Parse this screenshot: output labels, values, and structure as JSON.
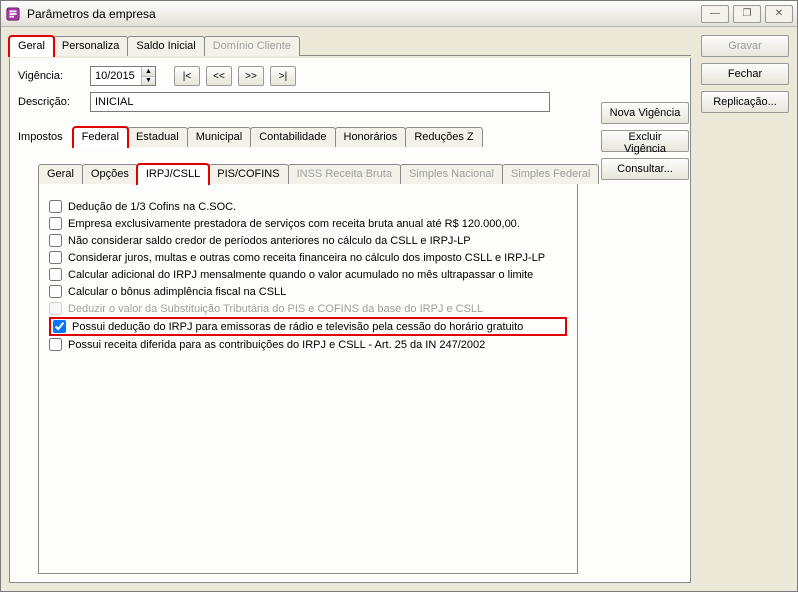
{
  "window": {
    "title": "Parâmetros da empresa"
  },
  "titlebar_buttons": {
    "minimize_glyph": "—",
    "restore_glyph": "❐",
    "close_glyph": "✕"
  },
  "main_tabs": [
    {
      "label": "Geral",
      "selected": true,
      "highlight": true
    },
    {
      "label": "Personaliza"
    },
    {
      "label": "Saldo Inicial"
    },
    {
      "label": "Domínio Cliente",
      "disabled": true
    }
  ],
  "form": {
    "vigencia_label": "Vigência:",
    "vigencia_value": "10/2015",
    "nav": {
      "first": "|<",
      "prev": "<<",
      "next": ">>",
      "last": ">|"
    },
    "descricao_label": "Descrição:",
    "descricao_value": "INICIAL"
  },
  "impostos_label": "Impostos",
  "impostos_tabs": [
    {
      "label": "Federal",
      "selected": true,
      "highlight": true
    },
    {
      "label": "Estadual"
    },
    {
      "label": "Municipal"
    },
    {
      "label": "Contabilidade"
    },
    {
      "label": "Honorários"
    },
    {
      "label": "Reduções Z"
    }
  ],
  "inner_tabs": [
    {
      "label": "Geral"
    },
    {
      "label": "Opções"
    },
    {
      "label": "IRPJ/CSLL",
      "selected": true,
      "highlight": true
    },
    {
      "label": "PIS/COFINS"
    },
    {
      "label": "INSS Receita Bruta",
      "disabled": true
    },
    {
      "label": "Simples Nacional",
      "disabled": true
    },
    {
      "label": "Simples Federal",
      "disabled": true
    }
  ],
  "checkboxes": [
    {
      "label": "Dedução de 1/3 Cofins na C.SOC.",
      "checked": false
    },
    {
      "label": "Empresa exclusivamente prestadora de serviços com receita bruta anual até R$ 120.000,00.",
      "checked": false
    },
    {
      "label": "Não considerar saldo credor de períodos anteriores no cálculo da CSLL e IRPJ-LP",
      "checked": false
    },
    {
      "label": "Considerar juros, multas e outras como receita financeira no cálculo dos imposto CSLL e IRPJ-LP",
      "checked": false
    },
    {
      "label": "Calcular adicional do IRPJ mensalmente quando o valor acumulado no mês ultrapassar o limite",
      "checked": false
    },
    {
      "label": "Calcular o bônus adimplência fiscal na CSLL",
      "checked": false
    },
    {
      "label": "Deduzir o valor da Substituição Tributária do PIS e COFINS da base do IRPJ e CSLL",
      "checked": false,
      "disabled": true
    },
    {
      "label": "Possui dedução do IRPJ para emissoras de rádio e televisão pela cessão do horário gratuito",
      "checked": true,
      "highlight": true
    },
    {
      "label": "Possui receita diferida para as contribuições do IRPJ e CSLL - Art. 25 da IN 247/2002",
      "checked": false
    }
  ],
  "side_buttons": {
    "nova_vigencia": "Nova Vigência",
    "excluir_vigencia": "Excluir Vigência",
    "consultar": "Consultar...",
    "gravar": "Gravar",
    "fechar": "Fechar",
    "replicacao": "Replicação..."
  }
}
